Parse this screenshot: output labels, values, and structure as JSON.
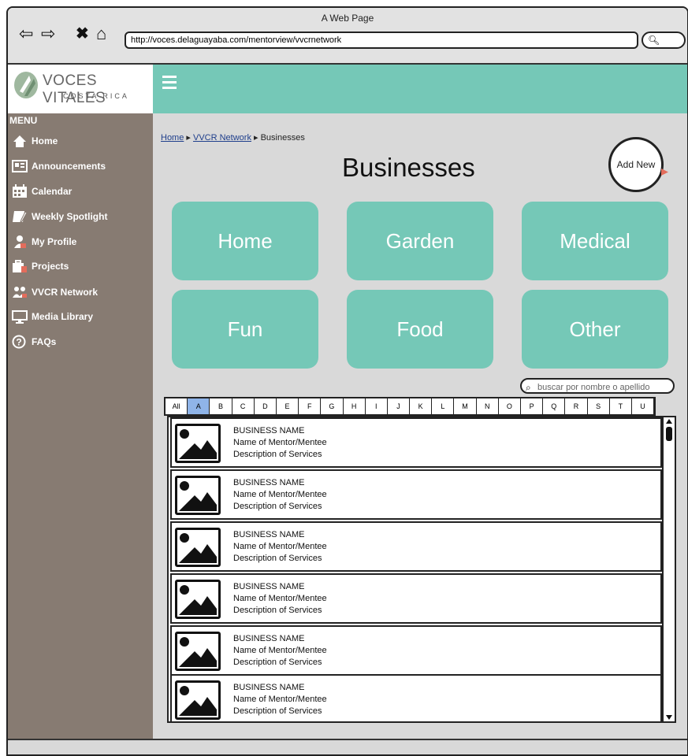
{
  "browser": {
    "title": "A Web Page",
    "url": "http://voces.delaguayaba.com/mentorview/vvcrnetwork",
    "search_icon": "search-icon"
  },
  "brand": {
    "name": "VOCES VITALES",
    "subtitle": "COSTA RICA",
    "accent": "#75c8b7",
    "sidebar_color": "#877b72"
  },
  "sidebar": {
    "label": "MENU",
    "items": [
      {
        "label": "Home",
        "icon": "home-icon"
      },
      {
        "label": "Announcements",
        "icon": "newspaper-icon"
      },
      {
        "label": "Calendar",
        "icon": "calendar-icon"
      },
      {
        "label": "Weekly Spotlight",
        "icon": "notebook-icon"
      },
      {
        "label": "My Profile",
        "icon": "user-icon"
      },
      {
        "label": "Projects",
        "icon": "briefcase-icon"
      },
      {
        "label": "VVCR Network",
        "icon": "network-icon"
      },
      {
        "label": "Media Library",
        "icon": "monitor-icon"
      },
      {
        "label": "FAQs",
        "icon": "help-icon"
      }
    ]
  },
  "breadcrumb": {
    "home": "Home",
    "network": "VVCR Network",
    "current": "Businesses"
  },
  "page": {
    "title": "Businesses",
    "add_new": "Add New"
  },
  "categories": [
    "Home",
    "Garden",
    "Medical",
    "Fun",
    "Food",
    "Other"
  ],
  "search": {
    "placeholder": "buscar por nombre o apellido"
  },
  "alphabet": {
    "letters": [
      "All",
      "A",
      "B",
      "C",
      "D",
      "E",
      "F",
      "G",
      "H",
      "I",
      "J",
      "K",
      "L",
      "M",
      "N",
      "O",
      "P",
      "Q",
      "R",
      "S",
      "T",
      "U"
    ],
    "active": "A"
  },
  "businesses": [
    {
      "name": "BUSINESS NAME",
      "mentor": "Name of Mentor/Mentee",
      "description": "Description of Services"
    },
    {
      "name": "BUSINESS NAME",
      "mentor": "Name of Mentor/Mentee",
      "description": "Description of Services"
    },
    {
      "name": "BUSINESS NAME",
      "mentor": "Name of Mentor/Mentee",
      "description": "Description of Services"
    },
    {
      "name": "BUSINESS NAME",
      "mentor": "Name of Mentor/Mentee",
      "description": "Description of Services"
    },
    {
      "name": "BUSINESS NAME",
      "mentor": "Name of Mentor/Mentee",
      "description": "Description of Services"
    },
    {
      "name": "BUSINESS NAME",
      "mentor": "Name of Mentor/Mentee",
      "description": "Description of Services"
    }
  ]
}
